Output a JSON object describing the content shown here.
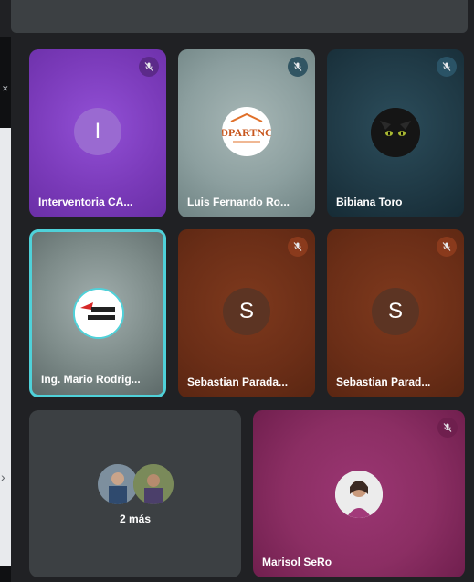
{
  "participants": [
    {
      "name": "Interventoria CA...",
      "initial": "I",
      "muted": true
    },
    {
      "name": "Luis Fernando Ro...",
      "logo_text": "DPARTNC",
      "muted": true
    },
    {
      "name": "Bibiana Toro",
      "muted": true
    },
    {
      "name": "Ing. Mario Rodrig...",
      "muted": false,
      "speaking": true
    },
    {
      "name": "Sebastian Parada...",
      "initial": "S",
      "muted": true
    },
    {
      "name": "Sebastian Parad...",
      "initial": "S",
      "muted": true
    },
    {
      "name": "Marisol SeRo",
      "muted": true
    }
  ],
  "overflow": {
    "label": "2 más"
  },
  "colors": {
    "interventoria": "#7e3fbf",
    "luis": "#8a9e9f",
    "bibiana": "#1f3a47",
    "mario": "#7f8c8a",
    "sebastian": "#6b2e17",
    "marisol": "#8b2e63",
    "speaking_border": "#4fd1d9"
  }
}
